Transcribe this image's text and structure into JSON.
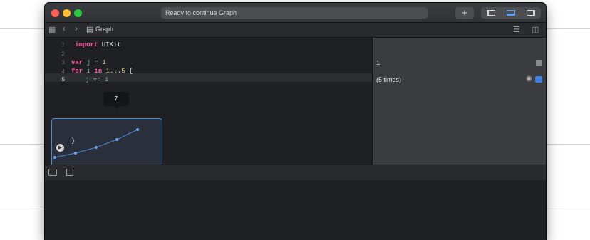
{
  "window": {
    "status_text": "Ready to continue Graph",
    "add_label": "+"
  },
  "navigator": {
    "breadcrumb_file": "Graph"
  },
  "editor": {
    "line_numbers": [
      "1",
      "2",
      "3",
      "4",
      "5",
      "6"
    ],
    "code": {
      "line1_kw": "import",
      "line1_rest": " UIKit",
      "line3_kw": "var",
      "line3_var": " j",
      "line3_op": " = ",
      "line3_num": "1",
      "line4_kw": "for",
      "line4_var": " i",
      "line4_in": " in",
      "line4_num1": " 1",
      "line4_range": "...",
      "line4_num2": "5",
      "line4_brace": " {",
      "line5_var1": "j",
      "line5_op": " += ",
      "line5_var2": "i",
      "line6": "}"
    }
  },
  "inline_graph": {
    "tooltip_value": "7"
  },
  "results": {
    "line3_result": "1",
    "line5_result": "(5 times)"
  },
  "icons": {
    "grid": "grid-icon",
    "back": "chevron-left-icon",
    "forward": "chevron-right-icon",
    "file": "swift-file-icon",
    "run": "play-icon",
    "eye": "quick-look-eye-icon",
    "inline": "show-result-icon"
  },
  "colors": {
    "keyword": "#fc5fa3",
    "number": "#d9c97c",
    "variable": "#67b7a4",
    "accent": "#4c88d6"
  }
}
